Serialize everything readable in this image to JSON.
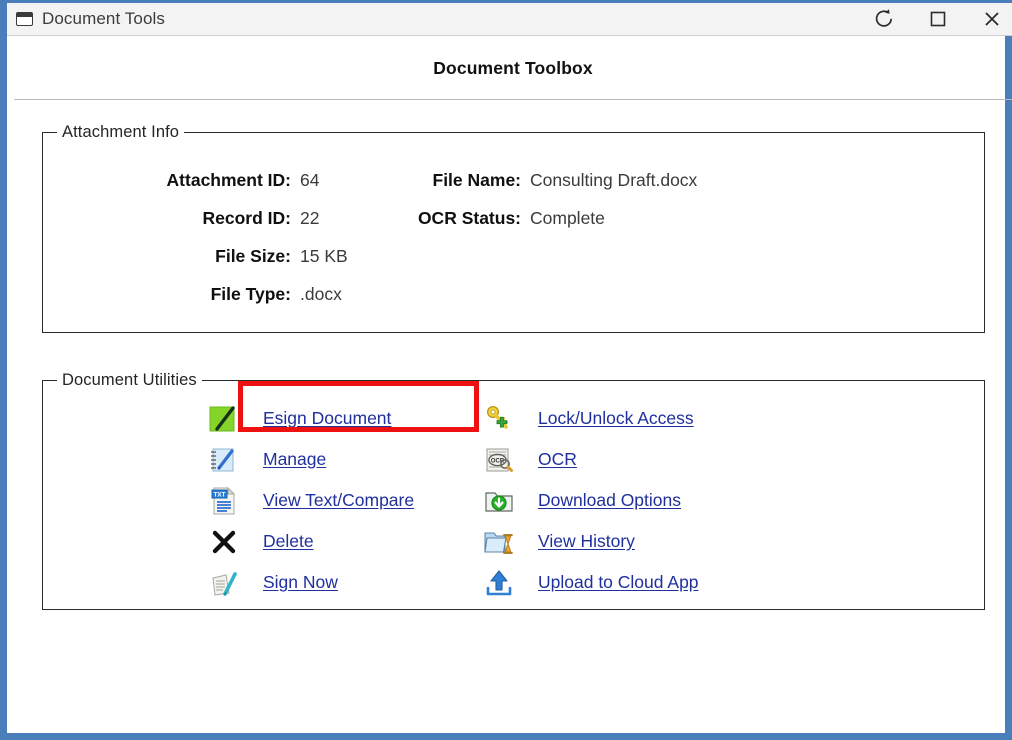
{
  "window": {
    "title": "Document Tools",
    "icon": "window-icon",
    "accent_color": "#4a7ebb",
    "buttons": [
      {
        "name": "refresh-button",
        "icon": "refresh-icon",
        "label": "Refresh"
      },
      {
        "name": "maximize-button",
        "icon": "maximize-icon",
        "label": "Maximize"
      },
      {
        "name": "close-button",
        "icon": "close-icon",
        "label": "Close"
      }
    ]
  },
  "header": {
    "title": "Document Toolbox"
  },
  "attachment_info": {
    "legend": "Attachment Info",
    "left_fields": [
      {
        "label": "Attachment ID:",
        "value": "64"
      },
      {
        "label": "Record ID:",
        "value": "22"
      },
      {
        "label": "File Size:",
        "value": "15 KB"
      },
      {
        "label": "File Type:",
        "value": ".docx"
      }
    ],
    "right_fields": [
      {
        "label": "File Name:",
        "value": "Consulting Draft.docx"
      },
      {
        "label": "OCR Status:",
        "value": "Complete"
      }
    ]
  },
  "document_utilities": {
    "legend": "Document Utilities",
    "left_items": [
      {
        "label": "Esign Document",
        "icon": "esign-document-icon",
        "highlighted": true
      },
      {
        "label": "Manage",
        "icon": "manage-notepad-icon",
        "highlighted": false
      },
      {
        "label": "View Text/Compare",
        "icon": "text-document-icon",
        "highlighted": false
      },
      {
        "label": "Delete",
        "icon": "delete-x-icon",
        "highlighted": false
      },
      {
        "label": "Sign Now",
        "icon": "sign-now-icon",
        "highlighted": false
      }
    ],
    "right_items": [
      {
        "label": "Lock/Unlock Access",
        "icon": "key-access-icon",
        "highlighted": false
      },
      {
        "label": "OCR",
        "icon": "ocr-scan-icon",
        "highlighted": false
      },
      {
        "label": "Download Options",
        "icon": "download-folder-icon",
        "highlighted": false
      },
      {
        "label": "View History",
        "icon": "history-folder-icon",
        "highlighted": false
      },
      {
        "label": "Upload to Cloud App",
        "icon": "upload-arrow-icon",
        "highlighted": false
      }
    ],
    "highlight_color": "#ee1111",
    "link_color": "#1f2f9e"
  }
}
